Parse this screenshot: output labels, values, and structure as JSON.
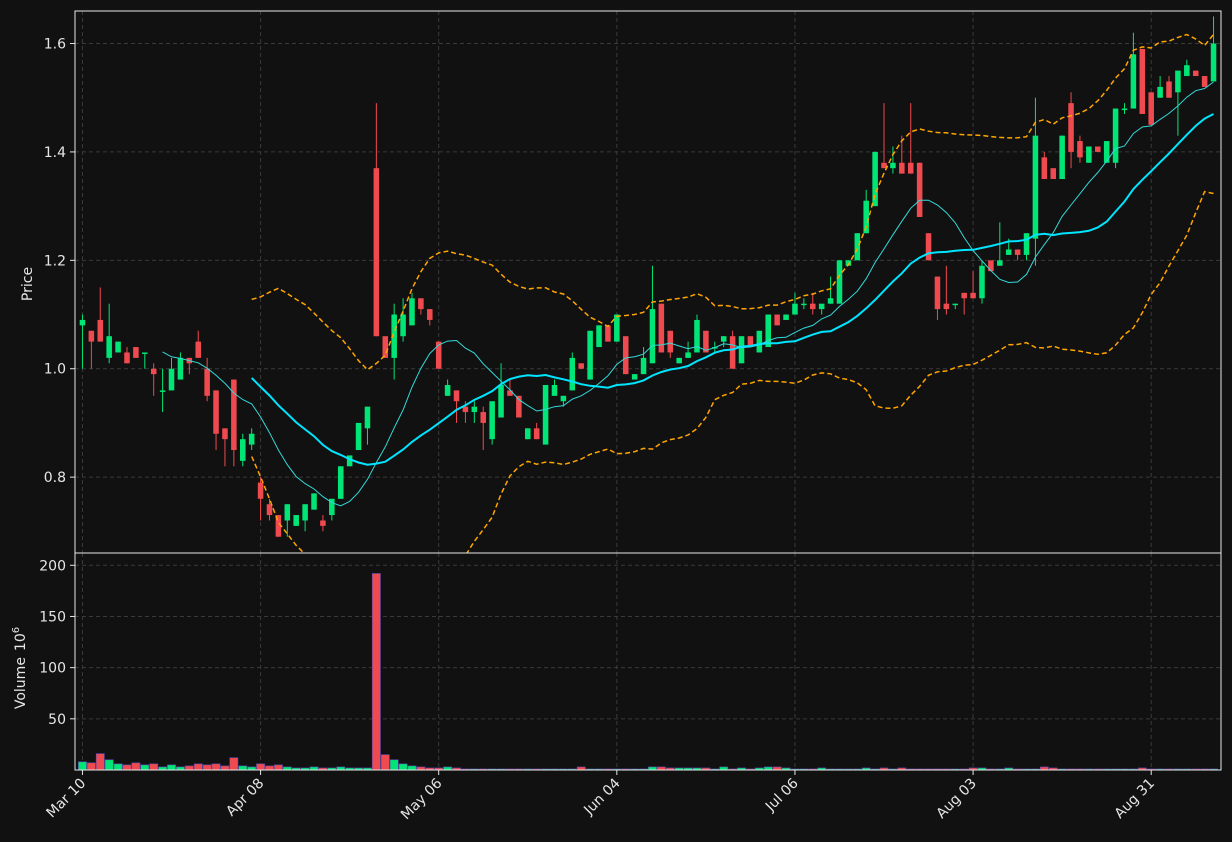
{
  "chart_data": {
    "type": "candlestick",
    "colors": {
      "background": "#111111",
      "up": "#00e676",
      "down": "#ef4a4f",
      "ma_fast": "#33d9d9",
      "ma_slow": "#00e5ff",
      "bands": "#ffa500",
      "grid": "#3a3a3a",
      "axis": "#e6e6e6"
    },
    "price_panel": {
      "ylabel": "Price",
      "ylim": [
        0.66,
        1.66
      ],
      "yticks": [
        "0.8",
        "1.0",
        "1.2",
        "1.4",
        "1.6"
      ],
      "ytick_values": [
        0.8,
        1.0,
        1.2,
        1.4,
        1.6
      ]
    },
    "volume_panel": {
      "ylabel": "Volume",
      "ylabel_exponent": "10",
      "ylabel_power": "6",
      "ylim": [
        0,
        212
      ],
      "yticks": [
        "50",
        "100",
        "150",
        "200"
      ],
      "ytick_values": [
        50,
        100,
        150,
        200
      ]
    },
    "x_ticks": [
      {
        "label": "Mar 10",
        "index": 0
      },
      {
        "label": "Apr 08",
        "index": 20
      },
      {
        "label": "May 06",
        "index": 40
      },
      {
        "label": "Jun 04",
        "index": 60
      },
      {
        "label": "Jul 06",
        "index": 80
      },
      {
        "label": "Aug 03",
        "index": 100
      },
      {
        "label": "Aug 31",
        "index": 120
      }
    ],
    "ohlc": [
      [
        1.08,
        1.1,
        1.0,
        1.09
      ],
      [
        1.07,
        1.07,
        1.0,
        1.05
      ],
      [
        1.09,
        1.15,
        1.05,
        1.05
      ],
      [
        1.02,
        1.12,
        1.01,
        1.06
      ],
      [
        1.03,
        1.05,
        1.03,
        1.05
      ],
      [
        1.03,
        1.04,
        1.01,
        1.01
      ],
      [
        1.04,
        1.04,
        1.02,
        1.02
      ],
      [
        1.03,
        1.03,
        1.0,
        1.03
      ],
      [
        1.0,
        1.01,
        0.95,
        0.99
      ],
      [
        0.96,
        1.0,
        0.92,
        0.96
      ],
      [
        0.96,
        1.02,
        0.96,
        1.0
      ],
      [
        0.98,
        1.03,
        0.98,
        1.02
      ],
      [
        1.02,
        1.02,
        0.99,
        1.01
      ],
      [
        1.05,
        1.07,
        1.02,
        1.02
      ],
      [
        1.0,
        1.02,
        0.94,
        0.95
      ],
      [
        0.96,
        0.96,
        0.85,
        0.88
      ],
      [
        0.89,
        0.89,
        0.82,
        0.87
      ],
      [
        0.98,
        0.98,
        0.82,
        0.85
      ],
      [
        0.83,
        0.88,
        0.82,
        0.87
      ],
      [
        0.86,
        0.89,
        0.85,
        0.88
      ],
      [
        0.79,
        0.8,
        0.72,
        0.76
      ],
      [
        0.75,
        0.76,
        0.72,
        0.73
      ],
      [
        0.73,
        0.73,
        0.69,
        0.69
      ],
      [
        0.72,
        0.75,
        0.69,
        0.75
      ],
      [
        0.71,
        0.73,
        0.71,
        0.73
      ],
      [
        0.72,
        0.75,
        0.7,
        0.75
      ],
      [
        0.74,
        0.77,
        0.74,
        0.77
      ],
      [
        0.72,
        0.73,
        0.7,
        0.71
      ],
      [
        0.73,
        0.76,
        0.72,
        0.76
      ],
      [
        0.76,
        0.82,
        0.76,
        0.82
      ],
      [
        0.82,
        0.84,
        0.82,
        0.84
      ],
      [
        0.85,
        0.9,
        0.85,
        0.9
      ],
      [
        0.89,
        0.93,
        0.86,
        0.93
      ],
      [
        1.37,
        1.49,
        1.06,
        1.06
      ],
      [
        1.06,
        1.06,
        1.02,
        1.02
      ],
      [
        1.02,
        1.12,
        0.98,
        1.1
      ],
      [
        1.06,
        1.13,
        1.05,
        1.1
      ],
      [
        1.08,
        1.14,
        1.08,
        1.13
      ],
      [
        1.13,
        1.13,
        1.1,
        1.11
      ],
      [
        1.11,
        1.11,
        1.08,
        1.09
      ],
      [
        1.05,
        1.05,
        1.0,
        1.0
      ],
      [
        0.95,
        0.98,
        0.95,
        0.97
      ],
      [
        0.96,
        0.96,
        0.9,
        0.94
      ],
      [
        0.93,
        0.94,
        0.9,
        0.92
      ],
      [
        0.92,
        0.94,
        0.9,
        0.93
      ],
      [
        0.92,
        0.93,
        0.85,
        0.9
      ],
      [
        0.87,
        0.94,
        0.86,
        0.94
      ],
      [
        0.91,
        1.01,
        0.91,
        0.97
      ],
      [
        0.96,
        0.98,
        0.95,
        0.95
      ],
      [
        0.95,
        0.95,
        0.91,
        0.91
      ],
      [
        0.87,
        0.89,
        0.87,
        0.89
      ],
      [
        0.89,
        0.9,
        0.87,
        0.87
      ],
      [
        0.86,
        0.97,
        0.86,
        0.97
      ],
      [
        0.95,
        0.98,
        0.95,
        0.97
      ],
      [
        0.94,
        0.95,
        0.93,
        0.95
      ],
      [
        0.96,
        1.03,
        0.96,
        1.02
      ],
      [
        1.01,
        1.01,
        1.0,
        1.0
      ],
      [
        0.98,
        1.07,
        0.98,
        1.07
      ],
      [
        1.04,
        1.08,
        1.04,
        1.08
      ],
      [
        1.08,
        1.08,
        1.05,
        1.05
      ],
      [
        1.05,
        1.1,
        1.05,
        1.1
      ],
      [
        1.06,
        1.06,
        0.99,
        0.99
      ],
      [
        0.98,
        0.99,
        0.98,
        0.99
      ],
      [
        0.99,
        1.04,
        0.99,
        1.02
      ],
      [
        1.01,
        1.19,
        1.01,
        1.11
      ],
      [
        1.12,
        1.12,
        1.03,
        1.03
      ],
      [
        1.07,
        1.07,
        1.02,
        1.03
      ],
      [
        1.01,
        1.02,
        1.01,
        1.02
      ],
      [
        1.02,
        1.05,
        1.02,
        1.03
      ],
      [
        1.03,
        1.1,
        1.03,
        1.09
      ],
      [
        1.07,
        1.07,
        1.03,
        1.03
      ],
      [
        1.04,
        1.05,
        1.03,
        1.04
      ],
      [
        1.05,
        1.06,
        1.04,
        1.06
      ],
      [
        1.06,
        1.07,
        1.0,
        1.0
      ],
      [
        1.01,
        1.06,
        1.01,
        1.06
      ],
      [
        1.06,
        1.06,
        1.04,
        1.04
      ],
      [
        1.03,
        1.07,
        1.03,
        1.07
      ],
      [
        1.04,
        1.1,
        1.04,
        1.1
      ],
      [
        1.1,
        1.1,
        1.08,
        1.08
      ],
      [
        1.09,
        1.1,
        1.09,
        1.1
      ],
      [
        1.1,
        1.14,
        1.1,
        1.12
      ],
      [
        1.12,
        1.13,
        1.11,
        1.12
      ],
      [
        1.12,
        1.14,
        1.1,
        1.11
      ],
      [
        1.11,
        1.11,
        1.1,
        1.12
      ],
      [
        1.12,
        1.17,
        1.12,
        1.13
      ],
      [
        1.12,
        1.2,
        1.12,
        1.2
      ],
      [
        1.19,
        1.19,
        1.2,
        1.2
      ],
      [
        1.2,
        1.25,
        1.2,
        1.25
      ],
      [
        1.25,
        1.33,
        1.25,
        1.31
      ],
      [
        1.3,
        1.4,
        1.3,
        1.4
      ],
      [
        1.38,
        1.49,
        1.38,
        1.37
      ],
      [
        1.37,
        1.41,
        1.36,
        1.38
      ],
      [
        1.38,
        1.43,
        1.36,
        1.36
      ],
      [
        1.38,
        1.49,
        1.36,
        1.36
      ],
      [
        1.38,
        1.38,
        1.28,
        1.28
      ],
      [
        1.25,
        1.25,
        1.2,
        1.2
      ],
      [
        1.17,
        1.17,
        1.09,
        1.11
      ],
      [
        1.12,
        1.19,
        1.1,
        1.11
      ],
      [
        1.12,
        1.12,
        1.11,
        1.12
      ],
      [
        1.14,
        1.14,
        1.1,
        1.13
      ],
      [
        1.14,
        1.18,
        1.13,
        1.13
      ],
      [
        1.13,
        1.2,
        1.12,
        1.19
      ],
      [
        1.2,
        1.2,
        1.2,
        1.18
      ],
      [
        1.19,
        1.27,
        1.19,
        1.2
      ],
      [
        1.21,
        1.24,
        1.21,
        1.22
      ],
      [
        1.22,
        1.22,
        1.2,
        1.21
      ],
      [
        1.21,
        1.25,
        1.2,
        1.25
      ],
      [
        1.24,
        1.5,
        1.19,
        1.43
      ],
      [
        1.39,
        1.4,
        1.35,
        1.35
      ],
      [
        1.37,
        1.37,
        1.35,
        1.35
      ],
      [
        1.35,
        1.43,
        1.35,
        1.43
      ],
      [
        1.49,
        1.51,
        1.37,
        1.4
      ],
      [
        1.42,
        1.43,
        1.38,
        1.39
      ],
      [
        1.38,
        1.41,
        1.38,
        1.41
      ],
      [
        1.41,
        1.41,
        1.4,
        1.4
      ],
      [
        1.38,
        1.42,
        1.38,
        1.42
      ],
      [
        1.38,
        1.48,
        1.37,
        1.48
      ],
      [
        1.48,
        1.49,
        1.47,
        1.48
      ],
      [
        1.48,
        1.62,
        1.48,
        1.58
      ],
      [
        1.59,
        1.59,
        1.47,
        1.47
      ],
      [
        1.51,
        1.51,
        1.45,
        1.45
      ],
      [
        1.5,
        1.54,
        1.5,
        1.52
      ],
      [
        1.53,
        1.54,
        1.5,
        1.5
      ],
      [
        1.51,
        1.55,
        1.43,
        1.55
      ],
      [
        1.54,
        1.57,
        1.54,
        1.56
      ],
      [
        1.55,
        1.55,
        1.54,
        1.54
      ],
      [
        1.54,
        1.54,
        1.52,
        1.52
      ],
      [
        1.53,
        1.65,
        1.53,
        1.6
      ]
    ],
    "volume": [
      8,
      7,
      16,
      10,
      6,
      5,
      7,
      5,
      6,
      3,
      5,
      3,
      4,
      6,
      5,
      6,
      4,
      12,
      4,
      3,
      6,
      4,
      5,
      3,
      2,
      2,
      3,
      2,
      2,
      3,
      2,
      2,
      2,
      192,
      15,
      10,
      6,
      4,
      3,
      2,
      2,
      3,
      2,
      1,
      1,
      1,
      1,
      1,
      1,
      1,
      1,
      1,
      1,
      1,
      1,
      1,
      3,
      1,
      1,
      1,
      1,
      1,
      1,
      1,
      3,
      3,
      2,
      2,
      2,
      2,
      2,
      1,
      3,
      1,
      2,
      1,
      2,
      3,
      3,
      2,
      1,
      1,
      1,
      2,
      1,
      1,
      1,
      1,
      2,
      1,
      2,
      1,
      2,
      1,
      1,
      1,
      1,
      1,
      1,
      1,
      2,
      2,
      1,
      1,
      2,
      1,
      1,
      1,
      3,
      2,
      1,
      1,
      1,
      1,
      1,
      1,
      1,
      1,
      1,
      2,
      1,
      1,
      1,
      1,
      1,
      1,
      1,
      1
    ],
    "ma_fast_period": 10,
    "ma_slow_period": 20,
    "band_period": 20,
    "band_width": 2
  }
}
